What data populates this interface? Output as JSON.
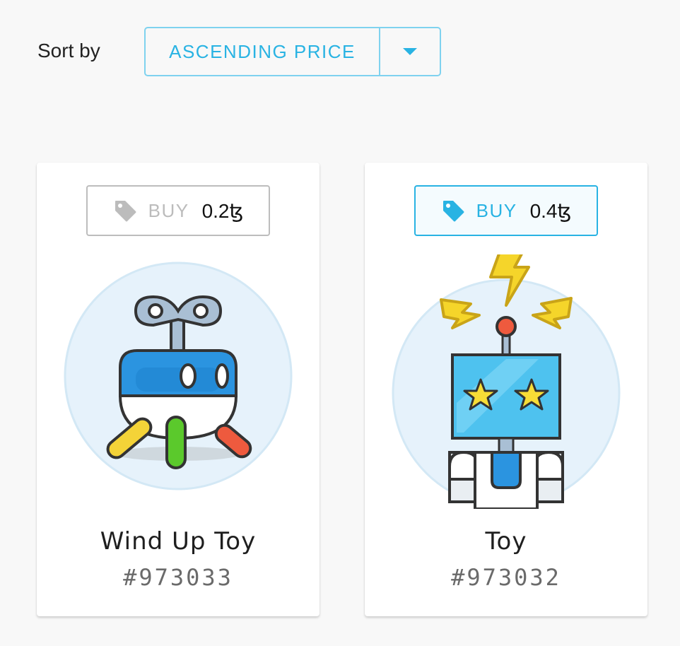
{
  "sort": {
    "label": "Sort by",
    "selected": "ASCENDING PRICE"
  },
  "colors": {
    "accent": "#29b3e3",
    "inactive_border": "#bdbdbd",
    "background": "#f8f8f8"
  },
  "cards": [
    {
      "buy_label": "BUY",
      "price": "0.2ꜩ",
      "name": "Wind Up Toy",
      "id": "#973033",
      "icon": "wind-up-toy-icon",
      "active": false
    },
    {
      "buy_label": "BUY",
      "price": "0.4ꜩ",
      "name": "Toy",
      "id": "#973032",
      "icon": "robot-toy-icon",
      "active": true
    }
  ]
}
